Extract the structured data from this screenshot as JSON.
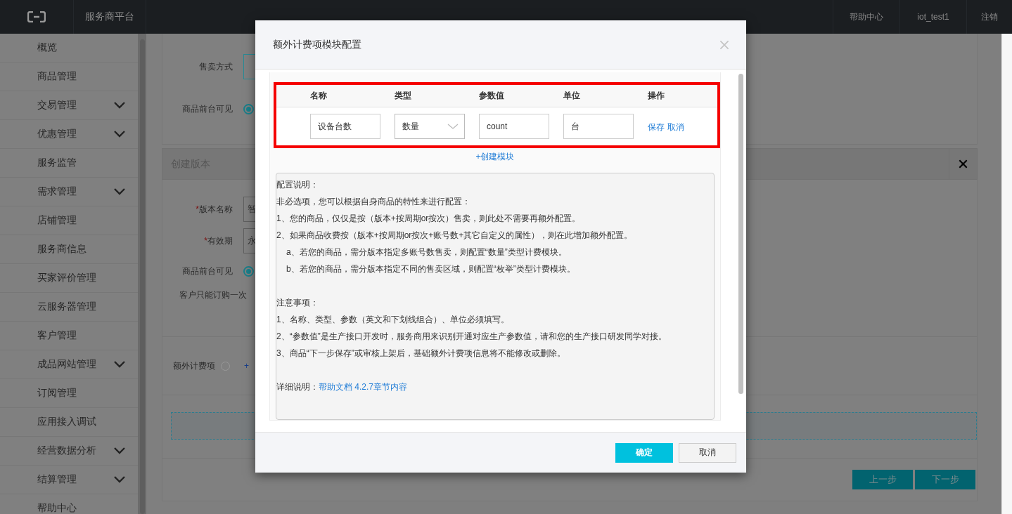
{
  "header": {
    "title": "服务商平台",
    "links": [
      "帮助中心",
      "iot_test1",
      "注销"
    ]
  },
  "sidebar": {
    "items": [
      {
        "label": "概览",
        "expandable": false
      },
      {
        "label": "商品管理",
        "expandable": false
      },
      {
        "label": "交易管理",
        "expandable": true
      },
      {
        "label": "优惠管理",
        "expandable": true
      },
      {
        "label": "服务监管",
        "expandable": false
      },
      {
        "label": "需求管理",
        "expandable": true
      },
      {
        "label": "店铺管理",
        "expandable": false
      },
      {
        "label": "服务商信息",
        "expandable": false
      },
      {
        "label": "买家评价管理",
        "expandable": false
      },
      {
        "label": "云服务器管理",
        "expandable": false
      },
      {
        "label": "客户管理",
        "expandable": false
      },
      {
        "label": "成品网站管理",
        "expandable": true
      },
      {
        "label": "订阅管理",
        "expandable": false
      },
      {
        "label": "应用接入调试",
        "expandable": false
      },
      {
        "label": "经营数据分析",
        "expandable": true
      },
      {
        "label": "结算管理",
        "expandable": true
      },
      {
        "label": "帮助中心",
        "expandable": false
      }
    ]
  },
  "product": {
    "sale_mode_label": "售卖方式",
    "visible_label": "商品前台可见",
    "visible_selected": true
  },
  "version": {
    "title": "创建版本",
    "name_field": {
      "required_mark": "*",
      "label": "版本名称",
      "value": "智"
    },
    "period_field": {
      "required_mark": "*",
      "label": "有效期",
      "value": "永"
    },
    "visible_label": "商品前台可见",
    "visible_selected": true,
    "once_label": "客户只能订购一次",
    "extra_label": "额外计费项",
    "extra_link": "+",
    "buttons": [
      "上一步",
      "下一步"
    ]
  },
  "modal": {
    "title": "额外计费项模块配置",
    "columns": [
      "名称",
      "类型",
      "参数值",
      "单位",
      "操作"
    ],
    "row": {
      "name": "设备台数",
      "type": "数量",
      "param": "count",
      "unit": "台",
      "actions": [
        "保存",
        "取消"
      ]
    },
    "create_link": "+创建模块",
    "notes": [
      {
        "kind": "text",
        "text": "配置说明："
      },
      {
        "kind": "text",
        "text": "非必选项，您可以根据自身商品的特性来进行配置："
      },
      {
        "kind": "text",
        "text": "1、您的商品，仅仅是按（版本+按周期or按次）售卖，则此处不需要再额外配置。"
      },
      {
        "kind": "text",
        "text": "2、如果商品收费按（版本+按周期or按次+账号数+其它自定义的属性），则在此增加额外配置。"
      },
      {
        "kind": "indent",
        "text": "a、若您的商品，需分版本指定多账号数售卖，则配置“数量”类型计费模块。"
      },
      {
        "kind": "indent",
        "text": "b、若您的商品，需分版本指定不同的售卖区域，则配置“枚举”类型计费模块。"
      },
      {
        "kind": "blank"
      },
      {
        "kind": "text",
        "text": "注意事项："
      },
      {
        "kind": "text",
        "text": "1、名称、类型、参数（英文和下划线组合）、单位必须填写。"
      },
      {
        "kind": "text",
        "text": "2、“参数值”是生产接口开发时，服务商用来识别开通对应生产参数值，请和您的生产接口研发同学对接。"
      },
      {
        "kind": "text",
        "text": "3、商品“下一步保存”或审核上架后，基础额外计费项信息将不能修改或删除。"
      },
      {
        "kind": "blank"
      },
      {
        "kind": "link",
        "text": "详细说明：",
        "link": "帮助文档 4.2.7章节内容"
      }
    ],
    "buttons": [
      "确定",
      "取消"
    ]
  }
}
